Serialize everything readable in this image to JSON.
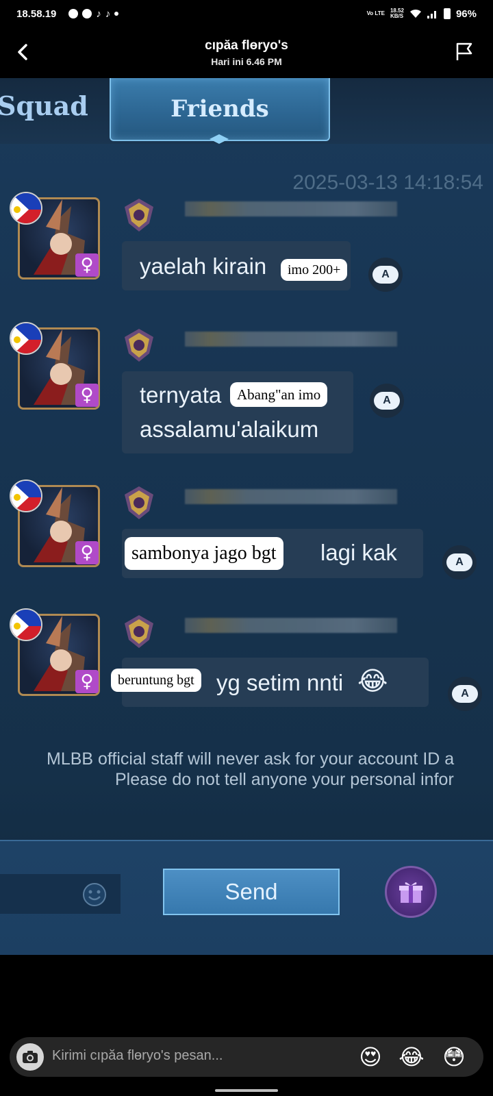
{
  "status_bar": {
    "time": "18.58.19",
    "signal_label_top": "18.52",
    "signal_label_bottom": "KB/S",
    "network": "Vo LTE",
    "battery": "96%"
  },
  "header": {
    "title": "cıpăa flɵryo's",
    "subtitle": "Hari ini 6.46 PM"
  },
  "game": {
    "tabs": [
      {
        "label": "Squad",
        "active": false
      },
      {
        "label": "Friends",
        "active": true
      }
    ],
    "timestamp": "2025-03-13 14:18:54",
    "messages": [
      {
        "lines": [
          "yaelah kirain"
        ],
        "overlay": "imo 200+"
      },
      {
        "lines": [
          "ternyata",
          "assalamu'alaikum"
        ],
        "overlay": "Abang\"an imo"
      },
      {
        "lines": [
          "lagi kak"
        ],
        "overlay": "sambonya jago bgt"
      },
      {
        "lines": [
          "yg setim nnti"
        ],
        "overlay": "beruntung bgt",
        "emoji": "😂"
      }
    ],
    "translate_label": "A",
    "notice_line1": "MLBB official staff will never ask for your account ID a",
    "notice_line2": "Please do not tell anyone your personal infor",
    "send_label": "Send",
    "female_symbol": "♀"
  },
  "reply": {
    "placeholder": "Kirimi cıpăa flɵryo's pesan...",
    "quick_emojis": [
      "😍",
      "😂",
      "😳"
    ]
  },
  "colors": {
    "bubble": "#263d55",
    "game_bg": "#173451",
    "send": "#3678ad",
    "female_badge": "#b04ac8"
  }
}
